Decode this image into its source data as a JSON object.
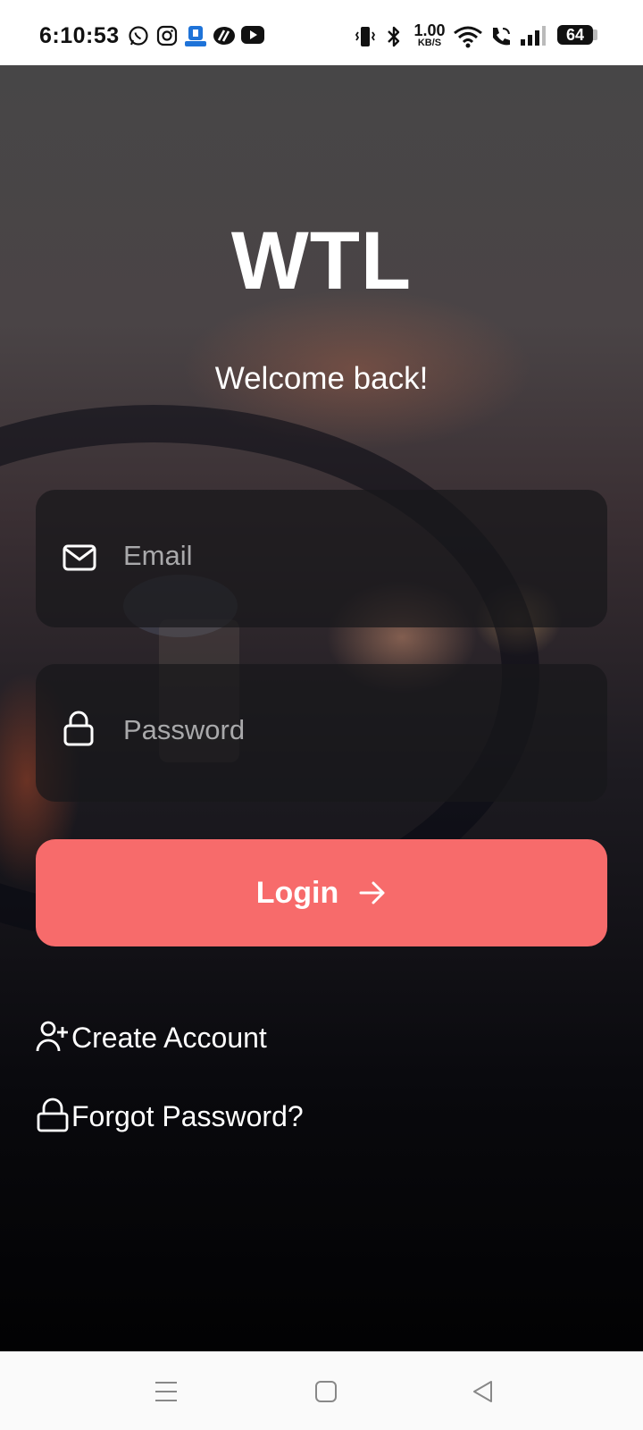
{
  "status_bar": {
    "time": "6:10:53",
    "net_speed_value": "1.00",
    "net_speed_unit": "KB/S",
    "battery": "64"
  },
  "app": {
    "title": "WTL",
    "subtitle": "Welcome back!"
  },
  "form": {
    "email_placeholder": "Email",
    "password_placeholder": "Password",
    "login_label": "Login"
  },
  "links": {
    "create_account": "Create Account",
    "forgot_password": "Forgot Password?"
  },
  "colors": {
    "accent": "#f76b6b",
    "field_bg": "#18181a"
  }
}
